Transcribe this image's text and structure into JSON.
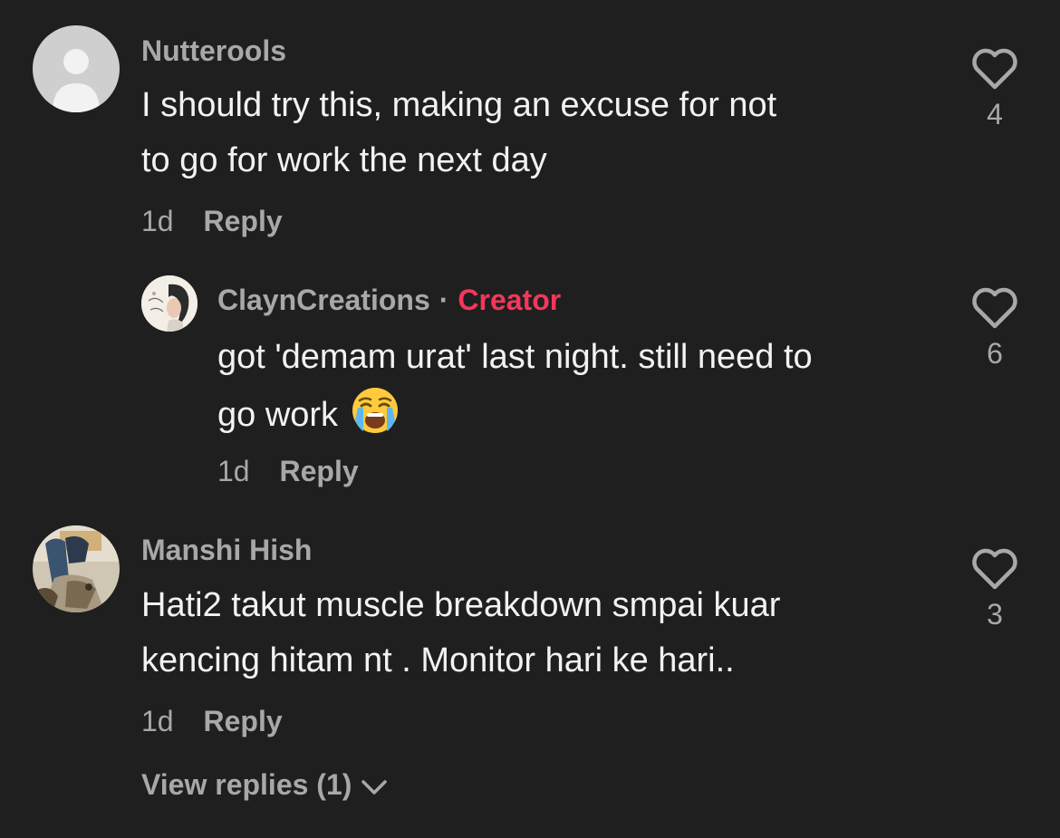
{
  "comments": [
    {
      "username": "Nutterools",
      "lines": [
        "I should try this, making an excuse for not",
        "to go for work the next day"
      ],
      "time": "1d",
      "reply_label": "Reply",
      "likes": "4",
      "avatar": "default-avatar-icon"
    },
    {
      "username": "ClaynCreations",
      "separator": "·",
      "badge": "Creator",
      "lines": [
        "got 'demam urat' last night. still need to",
        "go work"
      ],
      "emoji": "loudly-crying-face-emoji",
      "time": "1d",
      "reply_label": "Reply",
      "likes": "6",
      "avatar": "creator-avatar"
    },
    {
      "username": "Manshi Hish",
      "lines": [
        "Hati2 takut muscle breakdown smpai kuar",
        "kencing hitam nt . Monitor hari ke hari.."
      ],
      "time": "1d",
      "reply_label": "Reply",
      "likes": "3",
      "avatar": "user-photo-avatar"
    }
  ],
  "view_replies": {
    "label": "View replies (1)",
    "icon": "chevron-down-icon"
  },
  "colors": {
    "background": "#1f1f1f",
    "text_primary": "#f2f2f2",
    "text_secondary": "#a8a8a8",
    "creator_badge": "#f2385a"
  }
}
